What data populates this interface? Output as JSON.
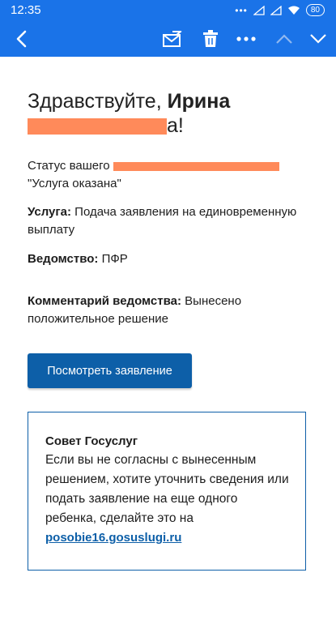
{
  "status_bar": {
    "time": "12:35",
    "dots": "•••",
    "battery": "80"
  },
  "toolbar": {
    "back_icon": "arrow-left-icon",
    "mark_unread_icon": "envelope-icon",
    "delete_icon": "trash-icon",
    "more_icon": "more-icon",
    "prev_icon": "chevron-up-icon",
    "next_icon": "chevron-down-icon"
  },
  "email": {
    "greeting_prefix": "Здравствуйте, ",
    "greeting_name": "Ирина",
    "greeting_end": "а!",
    "status_prefix": "Статус вашего",
    "status_value": "\"Услуга оказана\"",
    "service_label": "Услуга:",
    "service_value": "Подача заявления на единовременную выплату",
    "agency_label": "Ведомство:",
    "agency_value": "ПФР",
    "comment_label": "Комментарий ведомства:",
    "comment_value": "Вынесено положительное решение",
    "button_label": "Посмотреть заявление",
    "advice_title": "Совет Госуслуг",
    "advice_text": "Если вы не согласны с вынесенным решением, хотите уточнить сведения или подать заявление на еще одного ребенка, сделайте это на",
    "advice_link": "posobie16.gosuslugi.ru"
  },
  "colors": {
    "toolbar": "#1a73e8",
    "button": "#0d5fa8",
    "redaction": "#ff8a5a"
  }
}
